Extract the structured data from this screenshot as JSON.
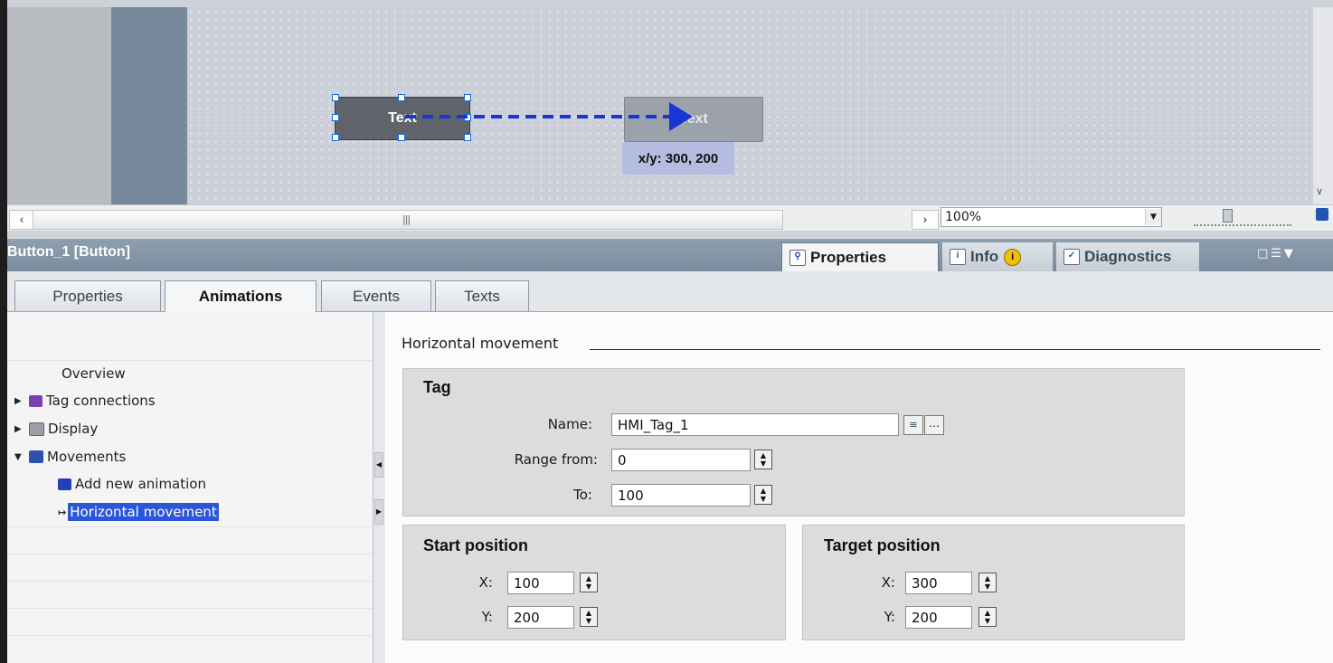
{
  "canvas": {
    "source_button_text": "Text",
    "target_button_text": "Text",
    "position_label": "x/y: 300, 200",
    "zoom": "100%"
  },
  "inspector": {
    "title": "Button_1 [Button]",
    "top_tabs": [
      {
        "label": "Properties",
        "icon": "properties-icon"
      },
      {
        "label": "Info",
        "icon": "info-icon"
      },
      {
        "label": "Diagnostics",
        "icon": "diagnostics-icon"
      }
    ],
    "sub_tabs": [
      "Properties",
      "Animations",
      "Events",
      "Texts"
    ],
    "active_sub_tab": "Animations"
  },
  "tree": {
    "items": [
      {
        "label": "Overview"
      },
      {
        "label": "Tag connections",
        "icon": "tag-connection-icon"
      },
      {
        "label": "Display",
        "icon": "display-icon"
      },
      {
        "label": "Movements",
        "icon": "movement-icon"
      },
      {
        "label": "Add new animation",
        "icon": "add-animation-icon"
      },
      {
        "label": "Horizontal movement",
        "icon": "horizontal-movement-icon"
      }
    ],
    "selected": "Horizontal movement"
  },
  "detail": {
    "section_title": "Horizontal movement",
    "tag_group": {
      "title": "Tag",
      "name_label": "Name:",
      "name_value": "HMI_Tag_1",
      "range_from_label": "Range from:",
      "range_from_value": "0",
      "to_label": "To:",
      "to_value": "100"
    },
    "start_group": {
      "title": "Start position",
      "x_label": "X:",
      "x_value": "100",
      "y_label": "Y:",
      "y_value": "200"
    },
    "target_group": {
      "title": "Target position",
      "x_label": "X:",
      "x_value": "300",
      "y_label": "Y:",
      "y_value": "200"
    }
  },
  "colors": {
    "accent": "#1a35d6",
    "selection": "#2b56d8",
    "header": "#7f90a2"
  }
}
